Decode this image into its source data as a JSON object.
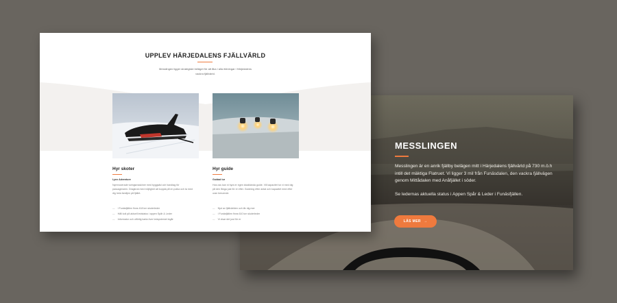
{
  "hero": {
    "title": "MESSLINGEN",
    "paragraph1": "Messlingen är en anrik fjällby belägen mitt i Härjedalens fjällvärld på 730 m.ö.h intill det mäktiga Flatruet. Vi ligger 3 mil från Funäsdalen, den vackra fjällvägen genom Mittådalen med Anåfjället i söder.",
    "paragraph2": "Se ledernas aktuella status i Appen Spår & Leder i Funäsfjällen.",
    "button_label": "LÄS MER",
    "button_arrow": "→"
  },
  "section": {
    "title": "UPPLEV HÄRJEDALENS FJÄLLVÄRLD",
    "intro": "Messlingen ligger strategiskt beläget för att åka i alla riktningar i Härjedalens vackra fjällvärld."
  },
  "cards": [
    {
      "title": "Hyr skoter",
      "subtitle": "Lynx Adventure",
      "description": "Nyrenoverade turingsmaskiner med byggsäd och handtag för passageraren. Dragkrok med möjlighet att koppla på en pulka och ta med dig hela familjen på fjället.",
      "bullets": [
        "I Funäsfjällen finns 418 km skoterleder",
        "Håll koll på aktuell ledstatus i appen Spår & Leder",
        "Informator och utförlig karta över ledsystemet ingår"
      ]
    },
    {
      "title": "Hyr guide",
      "subtitle": "Guidad tur",
      "description": "Hos oss kan ni hyra er egen lokalkända guide. Vill kapacitet tur vi med dig på den långa just för er efter. Guidning efter antal och kapacitet med efter uran beruende.",
      "bullets": [
        "Njut av fjällvärlden och lär dig mer",
        "I Funäsfjällen finns 610 km skoterleder",
        "Vi visar det just för er"
      ]
    }
  ],
  "colors": {
    "accent": "#ef7a3e",
    "background": "#69655f"
  }
}
